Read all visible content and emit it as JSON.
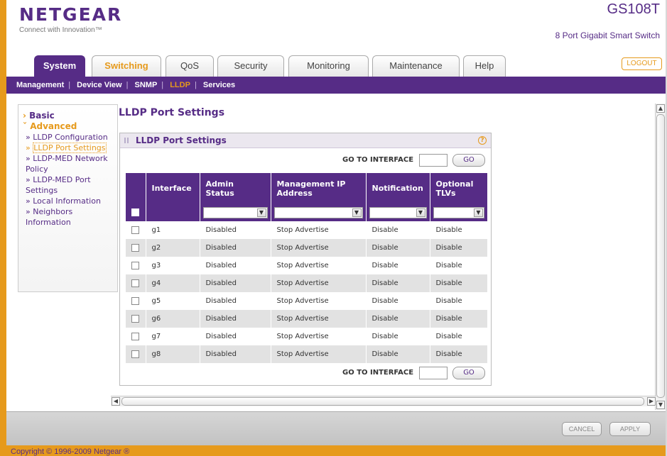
{
  "brand": {
    "logo": "NETGEAR",
    "tagline": "Connect with Innovation™",
    "model": "GS108T",
    "model_desc": "8 Port Gigabit Smart Switch"
  },
  "tabs": [
    {
      "label": "System",
      "state": "active"
    },
    {
      "label": "Switching",
      "state": "highlight"
    },
    {
      "label": "QoS"
    },
    {
      "label": "Security"
    },
    {
      "label": "Monitoring"
    },
    {
      "label": "Maintenance"
    },
    {
      "label": "Help"
    }
  ],
  "logout_label": "LOGOUT",
  "subnav": {
    "items": [
      "Management",
      "Device View",
      "SNMP",
      "LLDP",
      "Services"
    ],
    "active": "LLDP"
  },
  "sidenav": {
    "basic": "Basic",
    "advanced": "Advanced",
    "items": [
      "LLDP Configuration",
      "LLDP Port Settings",
      "LLDP-MED Network Policy",
      "LLDP-MED Port Settings",
      "Local Information",
      "Neighbors Information"
    ],
    "selected": "LLDP Port Settings"
  },
  "page_title": "LLDP Port Settings",
  "panel": {
    "title": "LLDP Port Settings",
    "help": "?",
    "goto_label": "GO TO INTERFACE",
    "go_label": "GO",
    "columns": [
      "Interface",
      "Admin Status",
      "Management IP Address",
      "Notification",
      "Optional TLVs"
    ],
    "rows": [
      {
        "interface": "g1",
        "admin": "Disabled",
        "mgmt": "Stop Advertise",
        "notification": "Disable",
        "tlvs": "Disable"
      },
      {
        "interface": "g2",
        "admin": "Disabled",
        "mgmt": "Stop Advertise",
        "notification": "Disable",
        "tlvs": "Disable"
      },
      {
        "interface": "g3",
        "admin": "Disabled",
        "mgmt": "Stop Advertise",
        "notification": "Disable",
        "tlvs": "Disable"
      },
      {
        "interface": "g4",
        "admin": "Disabled",
        "mgmt": "Stop Advertise",
        "notification": "Disable",
        "tlvs": "Disable"
      },
      {
        "interface": "g5",
        "admin": "Disabled",
        "mgmt": "Stop Advertise",
        "notification": "Disable",
        "tlvs": "Disable"
      },
      {
        "interface": "g6",
        "admin": "Disabled",
        "mgmt": "Stop Advertise",
        "notification": "Disable",
        "tlvs": "Disable"
      },
      {
        "interface": "g7",
        "admin": "Disabled",
        "mgmt": "Stop Advertise",
        "notification": "Disable",
        "tlvs": "Disable"
      },
      {
        "interface": "g8",
        "admin": "Disabled",
        "mgmt": "Stop Advertise",
        "notification": "Disable",
        "tlvs": "Disable"
      }
    ]
  },
  "buttons": {
    "cancel": "CANCEL",
    "apply": "APPLY"
  },
  "copyright": "Copyright © 1996-2009 Netgear ®",
  "colors": {
    "brand_purple": "#562c86",
    "accent_orange": "#e69a1c"
  }
}
